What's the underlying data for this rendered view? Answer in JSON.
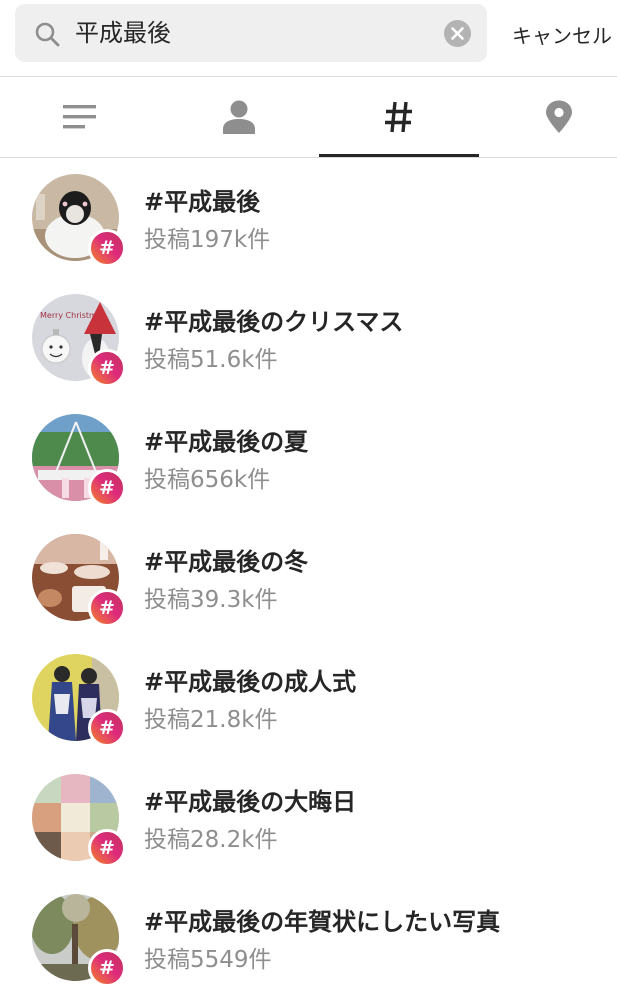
{
  "search": {
    "query": "平成最後",
    "cancel_label": "キャンセル"
  },
  "tabs": [
    {
      "name": "top",
      "icon": "list-lines-icon",
      "active": false
    },
    {
      "name": "accounts",
      "icon": "person-icon",
      "active": false
    },
    {
      "name": "tags",
      "icon": "hashtag-icon",
      "label": "#",
      "active": true
    },
    {
      "name": "places",
      "icon": "location-pin-icon",
      "active": false
    }
  ],
  "colors": {
    "text": "#262626",
    "secondary_text": "#8e8e8e",
    "search_background": "#efefef",
    "divider": "#dbdbdb",
    "icon_gray": "#8e8e8e",
    "badge_gradient": [
      "#f58529",
      "#dd2a7b",
      "#c1355e"
    ]
  },
  "results": [
    {
      "tag": "#平成最後",
      "posts": "投稿197k件",
      "thumbnail": "snowy-owl-ornament-photo"
    },
    {
      "tag": "#平成最後のクリスマス",
      "posts": "投稿51.6k件",
      "thumbnail": "christmas-ornament-photo"
    },
    {
      "tag": "#平成最後の夏",
      "posts": "投稿656k件",
      "thumbnail": "outdoor-tent-summer-photo"
    },
    {
      "tag": "#平成最後の冬",
      "posts": "投稿39.3k件",
      "thumbnail": "cafe-table-photo"
    },
    {
      "tag": "#平成最後の成人式",
      "posts": "投稿21.8k件",
      "thumbnail": "kimono-ceremony-photo"
    },
    {
      "tag": "#平成最後の大晦日",
      "posts": "投稿28.2k件",
      "thumbnail": "food-collage-photo"
    },
    {
      "tag": "#平成最後の年賀状にしたい写真",
      "posts": "投稿5549件",
      "thumbnail": "autumn-trees-photo"
    }
  ],
  "thumb_text": {
    "christmas": "Merry Christmas"
  }
}
